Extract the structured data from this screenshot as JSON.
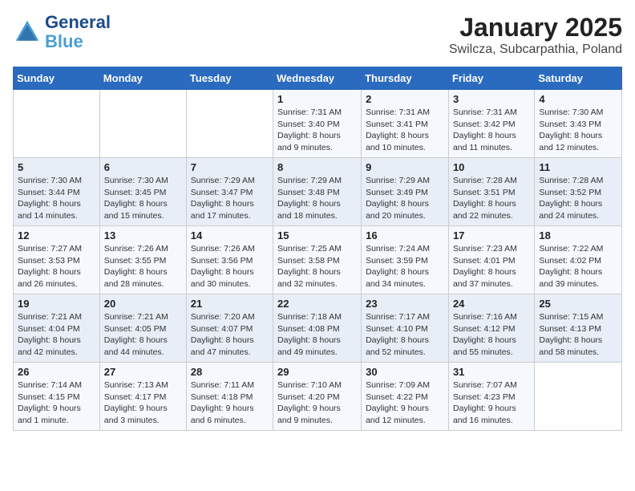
{
  "logo": {
    "line1": "General",
    "line2": "Blue"
  },
  "title": "January 2025",
  "subtitle": "Swilcza, Subcarpathia, Poland",
  "days_of_week": [
    "Sunday",
    "Monday",
    "Tuesday",
    "Wednesday",
    "Thursday",
    "Friday",
    "Saturday"
  ],
  "weeks": [
    [
      {
        "num": "",
        "info": ""
      },
      {
        "num": "",
        "info": ""
      },
      {
        "num": "",
        "info": ""
      },
      {
        "num": "1",
        "info": "Sunrise: 7:31 AM\nSunset: 3:40 PM\nDaylight: 8 hours\nand 9 minutes."
      },
      {
        "num": "2",
        "info": "Sunrise: 7:31 AM\nSunset: 3:41 PM\nDaylight: 8 hours\nand 10 minutes."
      },
      {
        "num": "3",
        "info": "Sunrise: 7:31 AM\nSunset: 3:42 PM\nDaylight: 8 hours\nand 11 minutes."
      },
      {
        "num": "4",
        "info": "Sunrise: 7:30 AM\nSunset: 3:43 PM\nDaylight: 8 hours\nand 12 minutes."
      }
    ],
    [
      {
        "num": "5",
        "info": "Sunrise: 7:30 AM\nSunset: 3:44 PM\nDaylight: 8 hours\nand 14 minutes."
      },
      {
        "num": "6",
        "info": "Sunrise: 7:30 AM\nSunset: 3:45 PM\nDaylight: 8 hours\nand 15 minutes."
      },
      {
        "num": "7",
        "info": "Sunrise: 7:29 AM\nSunset: 3:47 PM\nDaylight: 8 hours\nand 17 minutes."
      },
      {
        "num": "8",
        "info": "Sunrise: 7:29 AM\nSunset: 3:48 PM\nDaylight: 8 hours\nand 18 minutes."
      },
      {
        "num": "9",
        "info": "Sunrise: 7:29 AM\nSunset: 3:49 PM\nDaylight: 8 hours\nand 20 minutes."
      },
      {
        "num": "10",
        "info": "Sunrise: 7:28 AM\nSunset: 3:51 PM\nDaylight: 8 hours\nand 22 minutes."
      },
      {
        "num": "11",
        "info": "Sunrise: 7:28 AM\nSunset: 3:52 PM\nDaylight: 8 hours\nand 24 minutes."
      }
    ],
    [
      {
        "num": "12",
        "info": "Sunrise: 7:27 AM\nSunset: 3:53 PM\nDaylight: 8 hours\nand 26 minutes."
      },
      {
        "num": "13",
        "info": "Sunrise: 7:26 AM\nSunset: 3:55 PM\nDaylight: 8 hours\nand 28 minutes."
      },
      {
        "num": "14",
        "info": "Sunrise: 7:26 AM\nSunset: 3:56 PM\nDaylight: 8 hours\nand 30 minutes."
      },
      {
        "num": "15",
        "info": "Sunrise: 7:25 AM\nSunset: 3:58 PM\nDaylight: 8 hours\nand 32 minutes."
      },
      {
        "num": "16",
        "info": "Sunrise: 7:24 AM\nSunset: 3:59 PM\nDaylight: 8 hours\nand 34 minutes."
      },
      {
        "num": "17",
        "info": "Sunrise: 7:23 AM\nSunset: 4:01 PM\nDaylight: 8 hours\nand 37 minutes."
      },
      {
        "num": "18",
        "info": "Sunrise: 7:22 AM\nSunset: 4:02 PM\nDaylight: 8 hours\nand 39 minutes."
      }
    ],
    [
      {
        "num": "19",
        "info": "Sunrise: 7:21 AM\nSunset: 4:04 PM\nDaylight: 8 hours\nand 42 minutes."
      },
      {
        "num": "20",
        "info": "Sunrise: 7:21 AM\nSunset: 4:05 PM\nDaylight: 8 hours\nand 44 minutes."
      },
      {
        "num": "21",
        "info": "Sunrise: 7:20 AM\nSunset: 4:07 PM\nDaylight: 8 hours\nand 47 minutes."
      },
      {
        "num": "22",
        "info": "Sunrise: 7:18 AM\nSunset: 4:08 PM\nDaylight: 8 hours\nand 49 minutes."
      },
      {
        "num": "23",
        "info": "Sunrise: 7:17 AM\nSunset: 4:10 PM\nDaylight: 8 hours\nand 52 minutes."
      },
      {
        "num": "24",
        "info": "Sunrise: 7:16 AM\nSunset: 4:12 PM\nDaylight: 8 hours\nand 55 minutes."
      },
      {
        "num": "25",
        "info": "Sunrise: 7:15 AM\nSunset: 4:13 PM\nDaylight: 8 hours\nand 58 minutes."
      }
    ],
    [
      {
        "num": "26",
        "info": "Sunrise: 7:14 AM\nSunset: 4:15 PM\nDaylight: 9 hours\nand 1 minute."
      },
      {
        "num": "27",
        "info": "Sunrise: 7:13 AM\nSunset: 4:17 PM\nDaylight: 9 hours\nand 3 minutes."
      },
      {
        "num": "28",
        "info": "Sunrise: 7:11 AM\nSunset: 4:18 PM\nDaylight: 9 hours\nand 6 minutes."
      },
      {
        "num": "29",
        "info": "Sunrise: 7:10 AM\nSunset: 4:20 PM\nDaylight: 9 hours\nand 9 minutes."
      },
      {
        "num": "30",
        "info": "Sunrise: 7:09 AM\nSunset: 4:22 PM\nDaylight: 9 hours\nand 12 minutes."
      },
      {
        "num": "31",
        "info": "Sunrise: 7:07 AM\nSunset: 4:23 PM\nDaylight: 9 hours\nand 16 minutes."
      },
      {
        "num": "",
        "info": ""
      }
    ]
  ]
}
